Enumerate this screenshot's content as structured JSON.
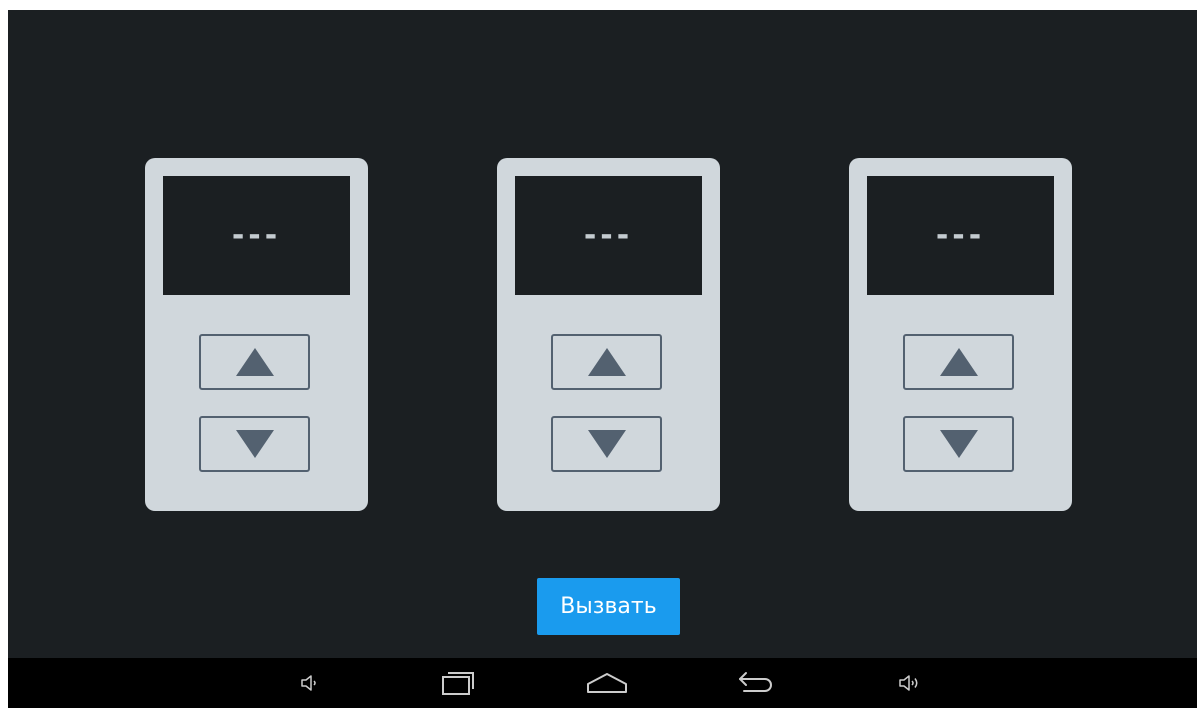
{
  "colors": {
    "background": "#1b1f22",
    "panel": "#d0d7dc",
    "display": "#1b1f22",
    "display_text": "#c4cbd0",
    "arrow": "#536170",
    "call_button": "#1a9bee",
    "navbar": "#000000"
  },
  "panels": [
    {
      "display": "---",
      "up_icon": "triangle-up-icon",
      "down_icon": "triangle-down-icon"
    },
    {
      "display": "---",
      "up_icon": "triangle-up-icon",
      "down_icon": "triangle-down-icon"
    },
    {
      "display": "---",
      "up_icon": "triangle-up-icon",
      "down_icon": "triangle-down-icon"
    }
  ],
  "call_button": {
    "label": "Вызвать"
  },
  "navbar": {
    "icons": [
      "volume-down-icon",
      "recent-apps-icon",
      "home-icon",
      "back-icon",
      "volume-up-icon"
    ]
  }
}
